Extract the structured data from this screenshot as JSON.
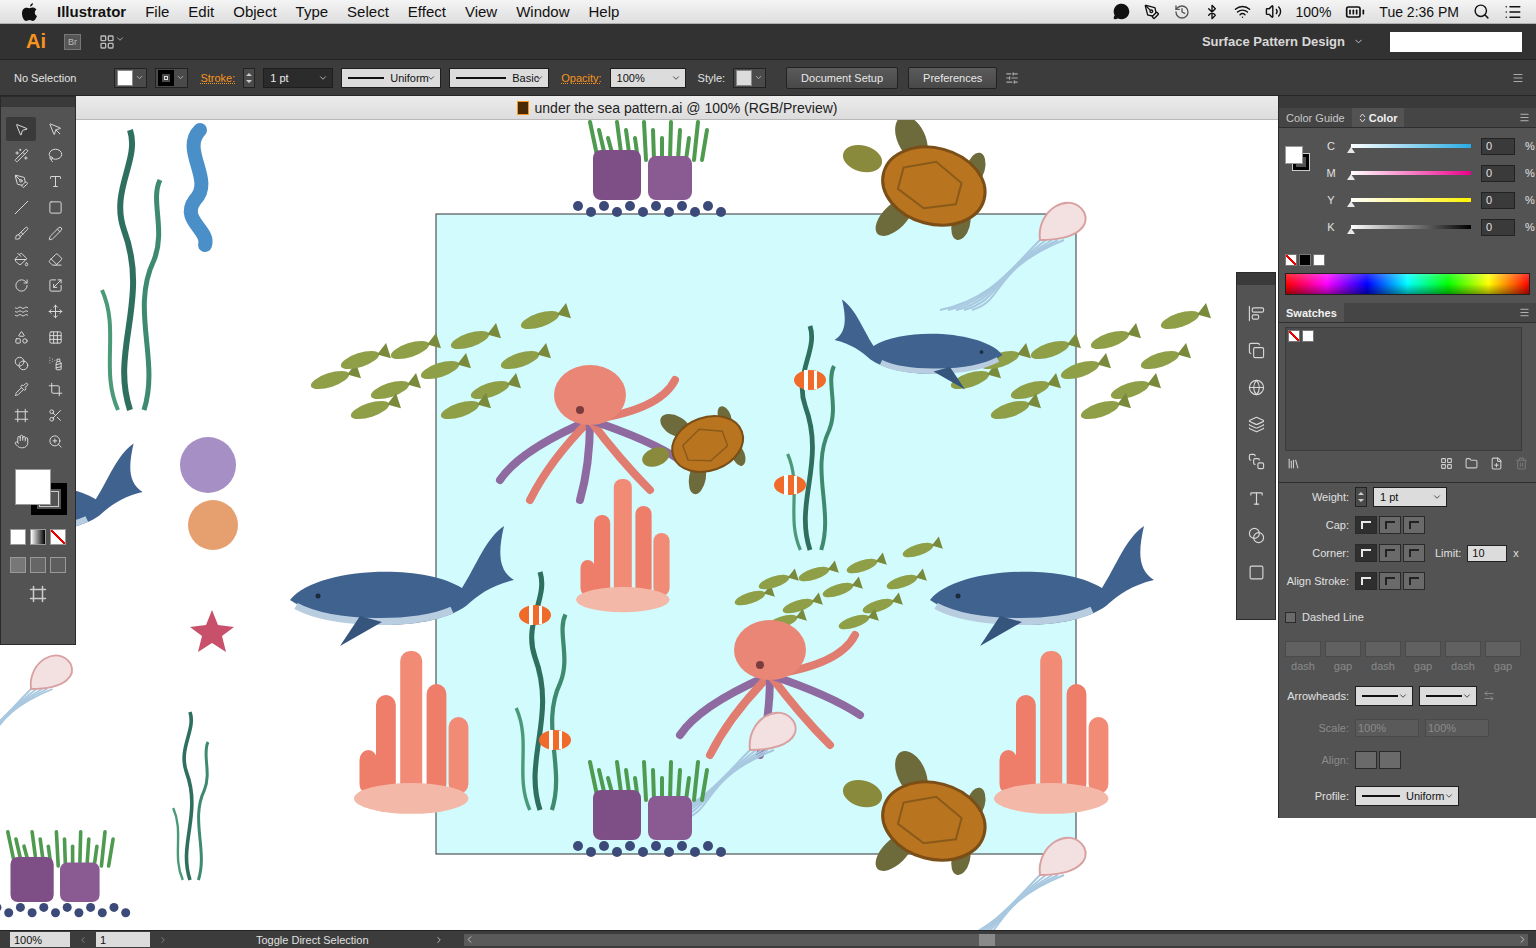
{
  "menubar": {
    "app": "Illustrator",
    "menus": [
      "File",
      "Edit",
      "Object",
      "Type",
      "Select",
      "Effect",
      "View",
      "Window",
      "Help"
    ],
    "battery": "100%",
    "clock": "Tue 2:36 PM"
  },
  "appbar": {
    "logo": "Ai",
    "bridge": "Br",
    "workspace": "Surface Pattern Design",
    "search": ""
  },
  "control": {
    "selection": "No Selection",
    "fill": "#ffffff",
    "stroke_color": "#000000",
    "stroke_label": "Stroke:",
    "weight": "1 pt",
    "profile": "Uniform",
    "brush": "Basic",
    "opacity_label": "Opacity:",
    "opacity": "100%",
    "style_label": "Style:",
    "buttons": [
      "Document Setup",
      "Preferences"
    ]
  },
  "document": {
    "title": "under the sea pattern.ai @ 100% (RGB/Preview)"
  },
  "toolbar": {
    "fill": "#ffffff",
    "stroke": "#000000"
  },
  "color_panel": {
    "tabs": [
      {
        "label": "Color Guide",
        "selected": false
      },
      {
        "label": "Color",
        "selected": true
      }
    ],
    "channels": [
      {
        "name": "C",
        "value": "0",
        "unit": "%",
        "level": 0,
        "color": "#29abe2"
      },
      {
        "name": "M",
        "value": "0",
        "unit": "%",
        "level": 0,
        "color": "#ec008c"
      },
      {
        "name": "Y",
        "value": "0",
        "unit": "%",
        "level": 0,
        "color": "#fff200"
      },
      {
        "name": "K",
        "value": "0",
        "unit": "%",
        "level": 0,
        "color": "#000000"
      }
    ]
  },
  "swatches": {
    "title": "Swatches"
  },
  "stroke_panel": {
    "weight_label": "Weight:",
    "weight": "1 pt",
    "cap_label": "Cap:",
    "caps": [
      {
        "selected": true
      },
      {
        "selected": false
      },
      {
        "selected": false
      }
    ],
    "corner_label": "Corner:",
    "corners": [
      {
        "selected": true
      },
      {
        "selected": false
      },
      {
        "selected": false
      }
    ],
    "limit_label": "Limit:",
    "limit": "10",
    "limit_unit": "x",
    "align_label": "Align Stroke:",
    "aligns": [
      {
        "selected": true
      },
      {
        "selected": false
      },
      {
        "selected": false
      }
    ],
    "dashed": {
      "label": "Dashed Line",
      "checked": false
    },
    "dash_fields": [
      "dash",
      "gap",
      "dash",
      "gap",
      "dash",
      "gap"
    ],
    "arrowheads_label": "Arrowheads:",
    "scale_label": "Scale:",
    "scale": [
      "100%",
      "100%"
    ],
    "scale_disabled": true,
    "align_arrows_label": "Align:",
    "profile_label": "Profile:",
    "profile": "Uniform"
  },
  "status": {
    "zoom": "100%",
    "page": "1",
    "message": "Toggle Direct Selection"
  }
}
